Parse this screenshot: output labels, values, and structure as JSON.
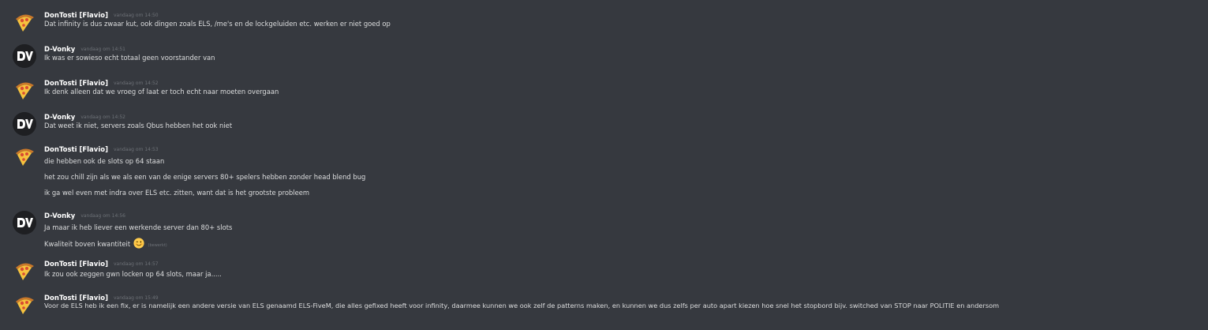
{
  "channel": {
    "messages": [
      {
        "author": "DonTosti [Flavio]",
        "avatar_icon": "pizza-icon",
        "time": "vandaag om 14:50",
        "lines": [
          {
            "text": "Dat infinity is dus zwaar kut, ook dingen zoals ELS, /me's en de lockgeluiden etc. werken er niet goed op"
          }
        ]
      },
      {
        "author": "D-Vonky",
        "avatar_icon": "dv-logo-icon",
        "time": "vandaag om 14:51",
        "lines": [
          {
            "text": "Ik was er sowieso echt totaal geen voorstander van"
          }
        ]
      },
      {
        "author": "DonTosti [Flavio]",
        "avatar_icon": "pizza-icon",
        "time": "vandaag om 14:52",
        "lines": [
          {
            "text": "Ik denk alleen dat we vroeg of laat er toch echt naar moeten overgaan"
          }
        ]
      },
      {
        "author": "D-Vonky",
        "avatar_icon": "dv-logo-icon",
        "time": "vandaag om 14:52",
        "lines": [
          {
            "text": "Dat weet ik niet, servers zoals Qbus hebben het ook niet"
          }
        ]
      },
      {
        "author": "DonTosti [Flavio]",
        "avatar_icon": "pizza-icon",
        "time": "vandaag om 14:53",
        "lines": [
          {
            "text": "die hebben ook de slots op 64 staan"
          },
          {
            "text": "het zou chill zijn als we als een van de enige servers 80+ spelers hebben zonder head blend bug"
          },
          {
            "text": "ik ga wel even met indra over ELS etc. zitten, want dat is het grootste probleem"
          }
        ]
      },
      {
        "author": "D-Vonky",
        "avatar_icon": "dv-logo-icon",
        "time": "vandaag om 14:56",
        "lines": [
          {
            "text": "Ja maar ik heb liever een werkende server dan 80+ slots"
          },
          {
            "text": "Kwaliteit boven kwantiteit",
            "emoji": "winking-face-emoji",
            "edited": "(bewerkt)"
          }
        ]
      },
      {
        "author": "DonTosti [Flavio]",
        "avatar_icon": "pizza-icon",
        "time": "vandaag om 14:57",
        "lines": [
          {
            "text": "Ik zou ook zeggen gwn locken op 64 slots, maar ja....."
          }
        ]
      },
      {
        "author": "DonTosti [Flavio]",
        "avatar_icon": "pizza-icon",
        "time": "vandaag om 15:49",
        "lines": [
          {
            "text": "Voor de ELS heb ik een fix, er is namelijk een andere versie van ELS genaamd ELS-FiveM, die alles gefixed heeft voor infinity, daarmee kunnen we ook zelf de patterns maken, en kunnen we dus zelfs per auto apart kiezen hoe snel het stopbord bijv. switched van STOP  naar POLITIE en andersom"
          }
        ]
      }
    ]
  },
  "colors": {
    "background": "#36393f",
    "username": "#ffffff",
    "text": "#dcddde",
    "timestamp": "#6d7177",
    "dv_avatar_bg": "#1e1f22"
  }
}
